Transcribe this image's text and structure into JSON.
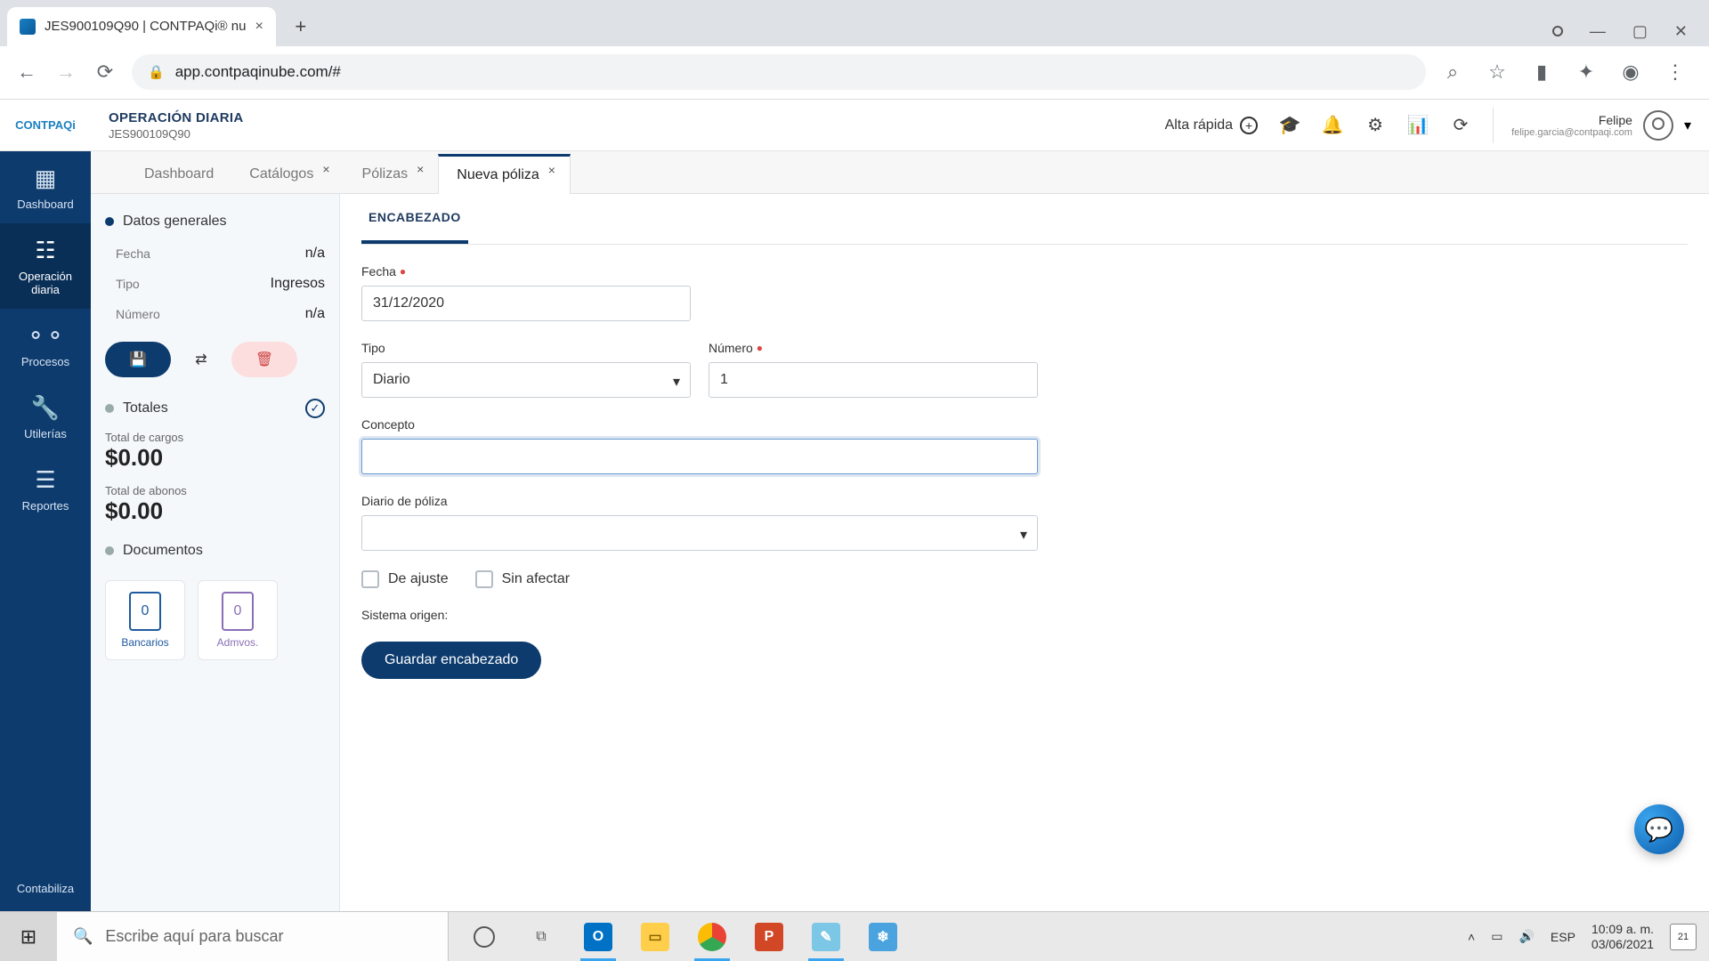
{
  "browser": {
    "tab_title": "JES900109Q90 | CONTPAQi® nu",
    "url": "app.contpaqinube.com/#"
  },
  "header": {
    "title": "OPERACIÓN DIARIA",
    "subtitle": "JES900109Q90",
    "alta_label": "Alta rápida",
    "user_name": "Felipe",
    "user_email": "felipe.garcia@contpaqi.com"
  },
  "left_nav": {
    "items": [
      {
        "label": "Dashboard"
      },
      {
        "label": "Operación diaria"
      },
      {
        "label": "Procesos"
      },
      {
        "label": "Utilerías"
      },
      {
        "label": "Reportes"
      }
    ],
    "footer": "Contabiliza"
  },
  "work_tabs": [
    {
      "label": "Dashboard",
      "closable": false
    },
    {
      "label": "Catálogos",
      "closable": true
    },
    {
      "label": "Pólizas",
      "closable": true
    },
    {
      "label": "Nueva póliza",
      "closable": true,
      "active": true
    }
  ],
  "side_panel": {
    "datos_generales": "Datos generales",
    "rows": [
      {
        "label": "Fecha",
        "value": "n/a"
      },
      {
        "label": "Tipo",
        "value": "Ingresos"
      },
      {
        "label": "Número",
        "value": "n/a"
      }
    ],
    "totales": "Totales",
    "cargos_label": "Total de cargos",
    "cargos_value": "$0.00",
    "abonos_label": "Total de abonos",
    "abonos_value": "$0.00",
    "documentos": "Documentos",
    "doc_cards": [
      {
        "count": "0",
        "label": "Bancarios"
      },
      {
        "count": "0",
        "label": "Admvos."
      }
    ]
  },
  "form": {
    "tab": "ENCABEZADO",
    "fecha_label": "Fecha",
    "fecha_value": "31/12/2020",
    "tipo_label": "Tipo",
    "tipo_value": "Diario",
    "numero_label": "Número",
    "numero_value": "1",
    "concepto_label": "Concepto",
    "concepto_value": "",
    "diario_label": "Diario de póliza",
    "diario_value": "",
    "ajuste_label": "De ajuste",
    "sinafectar_label": "Sin afectar",
    "sistema_label": "Sistema origen:",
    "save_label": "Guardar encabezado"
  },
  "taskbar": {
    "search_placeholder": "Escribe aquí para buscar",
    "lang": "ESP",
    "time": "10:09 a. m.",
    "date": "03/06/2021",
    "notif_count": "21"
  }
}
